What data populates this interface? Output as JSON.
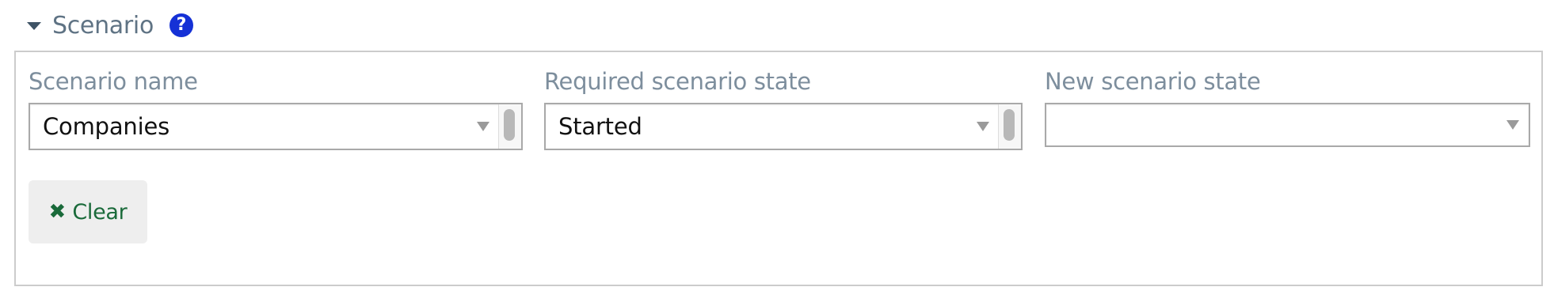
{
  "section": {
    "title": "Scenario",
    "help_icon": "question-circle-icon",
    "collapse_icon": "caret-down-icon"
  },
  "fields": {
    "scenario_name": {
      "label": "Scenario name",
      "value": "Companies"
    },
    "required_state": {
      "label": "Required scenario state",
      "value": "Started"
    },
    "new_state": {
      "label": "New scenario state",
      "value": ""
    }
  },
  "clear_button": {
    "label": "Clear",
    "icon": "times-icon"
  },
  "colors": {
    "help_icon": "#1531d6",
    "clear_text": "#1a6a3a",
    "label_text": "#7d8e9d"
  }
}
